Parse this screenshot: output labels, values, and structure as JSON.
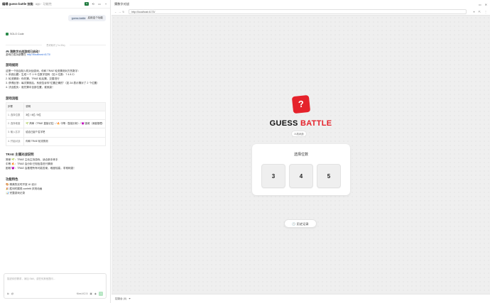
{
  "left_panel": {
    "title": "编辑 guess-battle 技能",
    "subtitle": "app · 功能性",
    "user_message": {
      "tag": "guess-battle",
      "text": "启用这个功能"
    },
    "solo_label": "SOLO Code",
    "divider": "思考耗时 (7m 35s)",
    "intro_title": "🎮 猜数字对战游戏已启动！",
    "intro_line_prefix": "游戏已成功部署在",
    "intro_link": "http://localhost:4173/",
    "rules_heading": "游戏规则",
    "rules_intro": "这是一个回合制人机对战游戏，你和 TRAE 轮流猜测对方的数字：",
    "rules": [
      "1. 系统出题：生成一个 1~5 位数字密码（如 4 位数：7 4 8 2）",
      "2. 轮流猜测：你先猜，TRAE 轮后猜，交替进行",
      "3. 获得反馈：每次猜测后，系统告诉你\"位置正确的\"（如 2A 表示猜对了 2 个位置）",
      "4. 决出胜负：谁先猜中全部位置，谁就赢！"
    ],
    "flow_heading": "游戏流程",
    "flow_table": {
      "headers": [
        "步骤",
        "说明"
      ],
      "rows": [
        [
          "1. 选择位数",
          "3位 / 4位 / 5位"
        ],
        [
          "2. 选择难度",
          "🌱 简单（TRAE 直接记住）/ 🔥 中等（智能分析）/ 😈 困难（深度推理）"
        ],
        [
          "3. 输入名字",
          "给自己起个名字吧"
        ],
        [
          "4. 开始对战",
          "你和 TRAE 轮流猜测"
        ]
      ]
    },
    "ai_heading": "TRAE 主播对战说明",
    "ai_items": [
      "简单 🌱：TRAE 主动主持游戏，适合新手练手",
      "中等 🔥：TRAE 会分析已知信息进行猜测",
      "困难 😈：TRAE 会推理所有可能答案，难度较高，非常刺激！"
    ],
    "feature_heading": "功能特色",
    "feature_items": [
      "🎨 精美的实时开放 UI 设计",
      "🎉 胜利时展现 confetti 庆祝动画",
      "📊 完整游戏记录"
    ],
    "input_placeholder": "描述你的需求，添加 Skill，或任何其他提问...",
    "model_label": "Kimi-K2.5",
    "colors": {
      "accent_green": "#2a8a4a",
      "link": "#2b6bd8"
    }
  },
  "browser": {
    "tab_title": "猜数字对战",
    "url": "http://localhost:4173/",
    "game": {
      "logo_glyph": "?",
      "title_part1": "GUESS ",
      "title_part2": "BATTLE",
      "subtitle": "人机对战",
      "select_label": "选择位数",
      "digit_options": [
        "3",
        "4",
        "5"
      ],
      "history_label": "🕓 历史记录"
    },
    "bottom_label": "控制台 (0)",
    "colors": {
      "brand_red": "#e5222b"
    }
  }
}
